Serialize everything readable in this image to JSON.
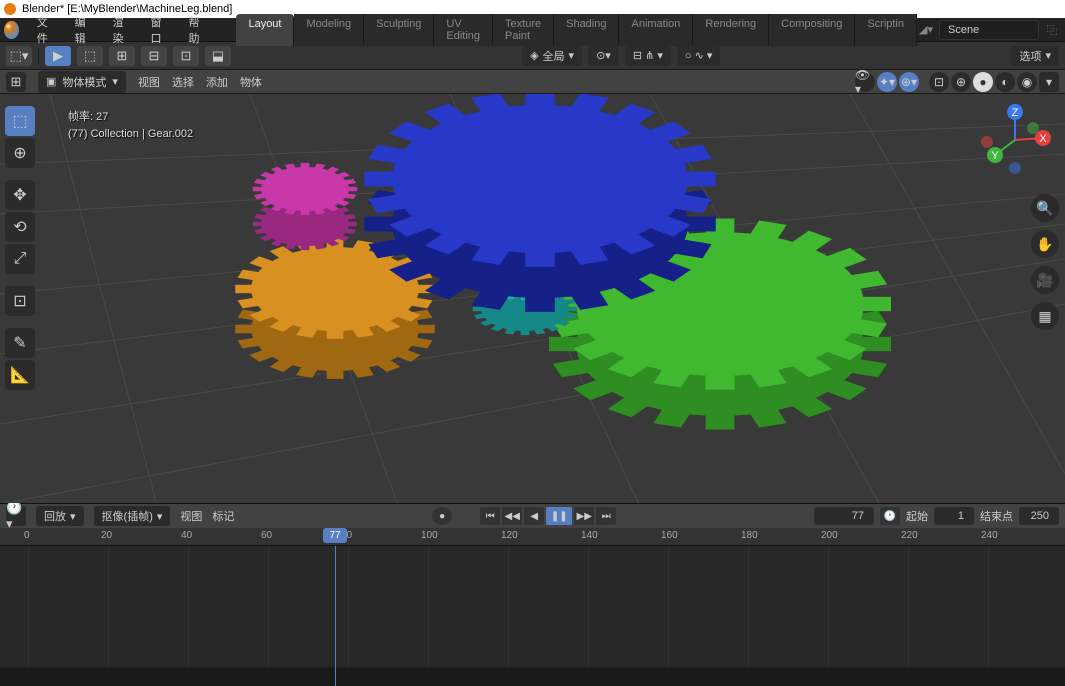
{
  "title": "Blender* [E:\\MyBlender\\MachineLeg.blend]",
  "menu": {
    "file": "文件",
    "edit": "编辑",
    "render": "渲染",
    "window": "窗口",
    "help": "帮助"
  },
  "tabs": [
    "Layout",
    "Modeling",
    "Sculpting",
    "UV Editing",
    "Texture Paint",
    "Shading",
    "Animation",
    "Rendering",
    "Compositing",
    "Scriptin"
  ],
  "active_tab": 0,
  "scene": {
    "label": "Scene"
  },
  "toolbar": {
    "orientation": "全局",
    "options_label": "选项"
  },
  "header2": {
    "mode": "物体模式",
    "view": "视图",
    "select": "选择",
    "add": "添加",
    "object": "物体"
  },
  "overlay": {
    "fps_label": "帧率: 27",
    "collection": "(77) Collection | Gear.002"
  },
  "gizmo": {
    "x": "X",
    "y": "Y",
    "z": "Z"
  },
  "timeline": {
    "playback": "回放",
    "keying": "抠像(插帧)",
    "view": "视图",
    "marker": "标记",
    "current": "77",
    "start_label": "起始",
    "start": "1",
    "end_label": "结束点",
    "end": "250",
    "marker_label": "77",
    "ticks": [
      "0",
      "20",
      "40",
      "60",
      "80",
      "100",
      "120",
      "140",
      "160",
      "180",
      "200",
      "220",
      "240"
    ]
  },
  "gears": {
    "blue_color": "#2030b8",
    "green_color": "#40b830",
    "orange_color": "#d89020",
    "magenta_color": "#c838a8",
    "cyan_color": "#20b0b0"
  }
}
